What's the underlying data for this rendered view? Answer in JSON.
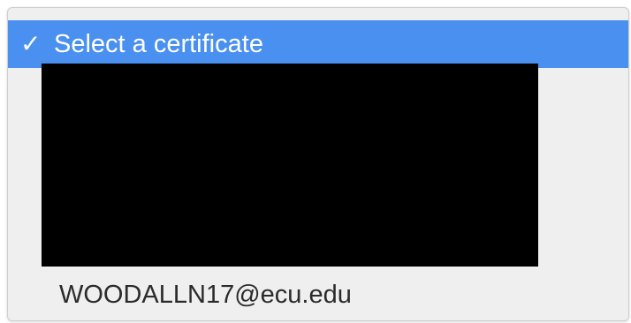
{
  "menu": {
    "selected_item": {
      "check_mark": "✓",
      "label": "Select a certificate"
    },
    "items": [
      {
        "label": "WOODALLN17@ecu.edu"
      }
    ]
  },
  "colors": {
    "highlight": "#4a90f0",
    "menu_background": "#efefef",
    "redaction": "#000000",
    "text": "#2b2b2b"
  },
  "icons": {
    "selected_check": "checkmark-icon"
  }
}
